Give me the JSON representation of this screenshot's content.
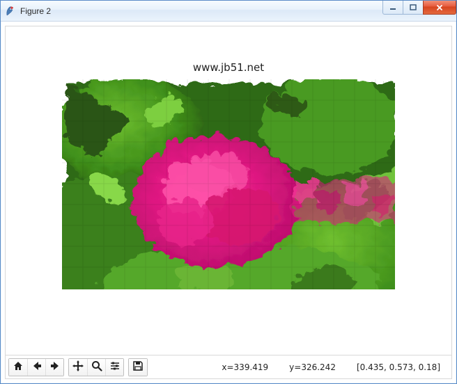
{
  "window": {
    "title": "Figure 2"
  },
  "figure": {
    "title": "www.jb51.net"
  },
  "toolbar": {
    "home_icon": "home-icon",
    "back_icon": "arrow-left-icon",
    "forward_icon": "arrow-right-icon",
    "pan_icon": "move-icon",
    "zoom_icon": "magnify-icon",
    "subplots_icon": "sliders-icon",
    "save_icon": "save-icon"
  },
  "status": {
    "x_label": "x=339.419",
    "y_label": "y=326.242",
    "rgb_label": "[0.435, 0.573, 0.18]"
  }
}
